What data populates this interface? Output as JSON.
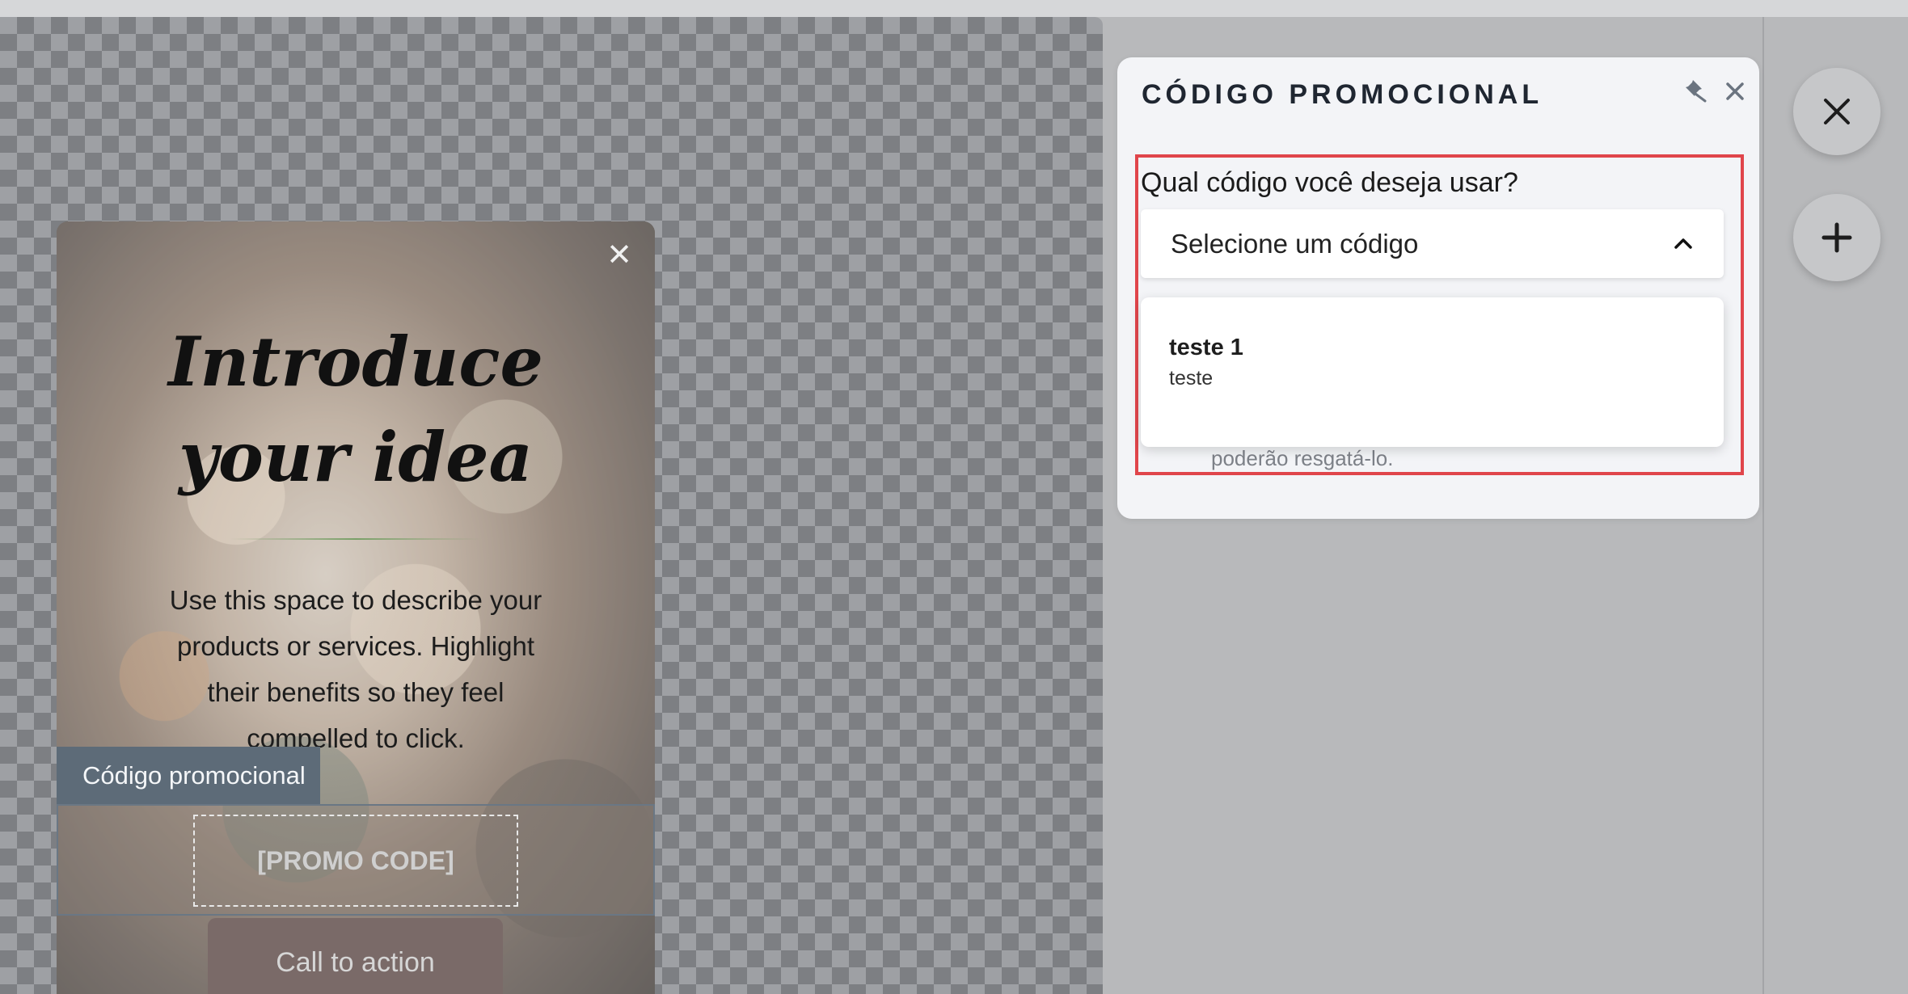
{
  "canvas": {
    "popup": {
      "close_symbol": "✕",
      "title_line1": "Introduce",
      "title_line2": "your idea",
      "description": "Use this space to describe your products or services. Highlight their benefits so they feel compelled to click.",
      "code_label": "Código promocional",
      "promo_placeholder": "[PROMO CODE]",
      "cta_label": "Call to action"
    }
  },
  "panel": {
    "title": "CÓDIGO PROMOCIONAL",
    "question": "Qual código você deseja usar?",
    "select": {
      "selected_text": "Selecione um código",
      "expanded": true
    },
    "options": [
      {
        "name": "teste 1",
        "description": "teste"
      }
    ],
    "helper_text_partial": "poderão resgatá-lo."
  },
  "sidebar": {
    "close_button_icon": "close-icon",
    "add_button_icon": "plus-icon"
  },
  "colors": {
    "highlight_border": "#e0454b",
    "panel_bg": "#f3f4f7",
    "code_label_bg": "#5d6b78"
  }
}
